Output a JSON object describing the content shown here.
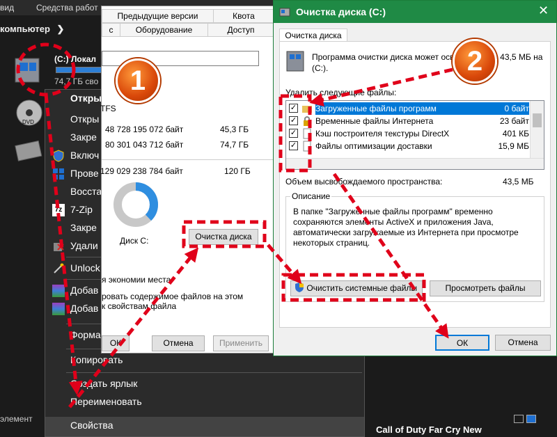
{
  "explorer": {
    "ribbon_left": "вид",
    "ribbon_tools": "Средства работ",
    "address": "компьютер",
    "drive_label": "(C:) Локал",
    "drive_free": "74,7 ГБ сво",
    "status_text": "элемент",
    "games_text": "Call of Duty   Far Cry New"
  },
  "context_menu": {
    "items": [
      {
        "label": "Откры",
        "icon": "none"
      },
      {
        "label": "Откры",
        "icon": "none"
      },
      {
        "label": "Закре",
        "icon": "none"
      },
      {
        "label": "Включ",
        "icon": "shield-icon"
      },
      {
        "label": "Прове",
        "icon": "defender-icon"
      },
      {
        "label": "Восста",
        "icon": "none"
      },
      {
        "label": "7-Zip",
        "icon": "7zip-icon"
      },
      {
        "label": "Закре",
        "icon": "none"
      },
      {
        "label": "Удали",
        "icon": "delete-icon"
      },
      {
        "label": "Unlock",
        "icon": "wand-icon"
      },
      {
        "label": "Добав",
        "icon": "archive-icon"
      },
      {
        "label": "Добав",
        "icon": "archive-icon"
      },
      {
        "label": "Форма",
        "icon": "none"
      },
      {
        "label": "Копировать",
        "icon": "none"
      },
      {
        "label": "Создать ярлык",
        "icon": "none"
      },
      {
        "label": "Переименовать",
        "icon": "none"
      },
      {
        "label": "Свойства",
        "icon": "none"
      }
    ]
  },
  "properties": {
    "tabs_row1": [
      "Предыдущие версии",
      "Квота"
    ],
    "tabs_row2": [
      "с",
      "Оборудование",
      "Доступ"
    ],
    "fs": "TFS",
    "used_bytes": "48 728 195 072 байт",
    "used_gb": "45,3 ГБ",
    "free_bytes": "80 301 043 712 байт",
    "free_gb": "74,7 ГБ",
    "total_bytes": "129 029 238 784 байт",
    "total_gb": "120 ГБ",
    "disk_label": "Диск С:",
    "cleanup_button": "Очистка диска",
    "compress_text": "я экономии места",
    "index_text1": "ровать содержимое файлов на этом",
    "index_text2": "к свойствам файла",
    "ok": "ОК",
    "cancel": "Отмена",
    "apply": "Применить",
    "chart": {
      "used": 45.3,
      "free": 74.7,
      "used_color": "#2f8ee0",
      "free_color": "#c8c8c8"
    }
  },
  "cleanup": {
    "title": "Очистка диска  (C:)",
    "tab": "Очистка диска",
    "intro": "Программа очистки диска может освободить до 43,5 МБ на  (С:).",
    "delete_label": "Удалить следующие файлы:",
    "files": [
      {
        "name": "Загруженные файлы программ",
        "size": "0 байт",
        "checked": true,
        "selected": true
      },
      {
        "name": "Временные файлы Интернета",
        "size": "23 байт",
        "checked": true,
        "selected": false
      },
      {
        "name": "Кэш построителя текстуры DirectX",
        "size": "401 КБ",
        "checked": true,
        "selected": false
      },
      {
        "name": "Файлы оптимизации доставки",
        "size": "15,9 МБ",
        "checked": true,
        "selected": false
      }
    ],
    "space_label": "Объем высвобождаемого пространства:",
    "space_value": "43,5 МБ",
    "desc_title": "Описание",
    "desc_text": "В папке \"Загруженные файлы программ\" временно сохраняются элементы ActiveX и приложения Java, автоматически загружаемые из Интернета при просмотре некоторых страниц.",
    "clean_system": "Очистить системные файлы",
    "view_files": "Просмотреть файлы",
    "ok": "ОК",
    "cancel": "Отмена"
  },
  "annotations": {
    "step1": "1",
    "step2": "2",
    "accent": "#d9480a",
    "arrow_color": "#e0001a"
  }
}
